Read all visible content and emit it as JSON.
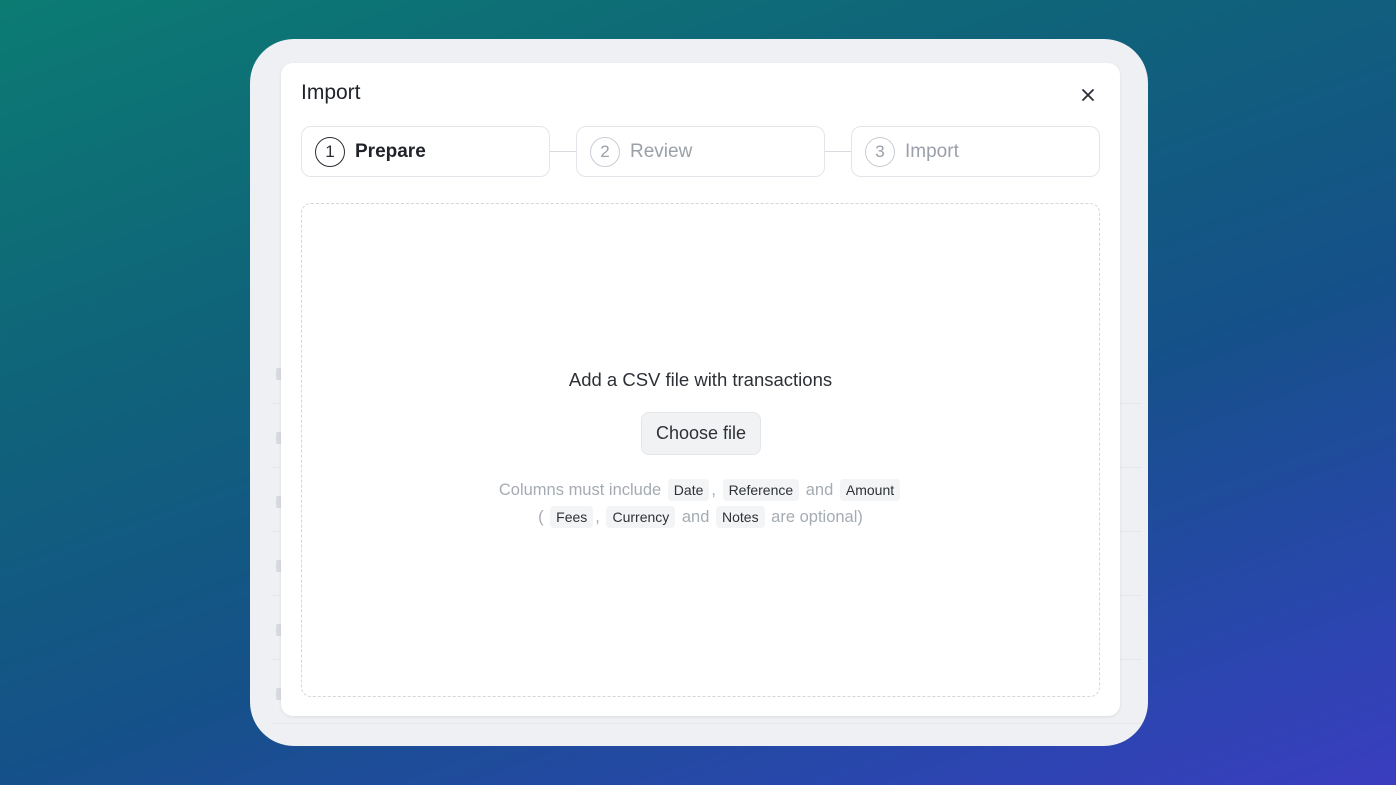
{
  "modal": {
    "title": "Import",
    "close_icon": "close-icon"
  },
  "steps": [
    {
      "number": "1",
      "label": "Prepare",
      "active": true
    },
    {
      "number": "2",
      "label": "Review",
      "active": false
    },
    {
      "number": "3",
      "label": "Import",
      "active": false
    }
  ],
  "dropzone": {
    "title": "Add a CSV file with transactions",
    "button_label": "Choose file",
    "req_prefix": "Columns must include",
    "required_columns": [
      "Date",
      "Reference",
      "Amount"
    ],
    "optional_columns": [
      "Fees",
      "Currency",
      "Notes"
    ],
    "comma": ",",
    "and": "and",
    "open_paren": "(",
    "optional_suffix": "are optional)"
  },
  "colors": {
    "bg_start": "#0c7c73",
    "bg_end": "#3a3dbf",
    "text_primary": "#1f2329",
    "text_muted": "#a5abb2"
  }
}
